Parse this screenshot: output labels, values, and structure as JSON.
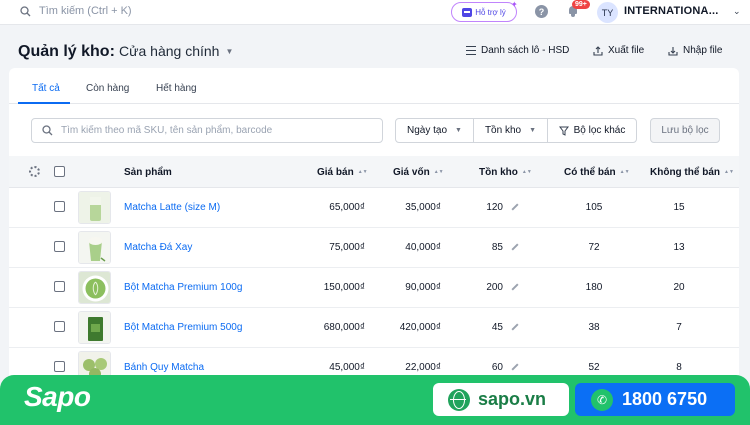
{
  "topbar": {
    "search_placeholder": "Tìm kiếm (Ctrl + K)",
    "help_label": "Hỗ trợ lý",
    "notification_count": "99+",
    "avatar_initials": "TY",
    "org_name": "INTERNATIONA..."
  },
  "header": {
    "title": "Quản lý kho:",
    "store": "Cửa hàng chính",
    "actions": [
      "Danh sách lô - HSD",
      "Xuất file",
      "Nhập file"
    ]
  },
  "tabs": [
    "Tất cả",
    "Còn hàng",
    "Hết hàng"
  ],
  "filters": {
    "search_placeholder": "Tìm kiếm theo mã SKU, tên sản phẩm, barcode",
    "date": "Ngày tạo",
    "stock": "Tồn kho",
    "other": "Bộ lọc khác",
    "save": "Lưu bộ lọc"
  },
  "table": {
    "columns": [
      "Sản phẩm",
      "Giá bán",
      "Giá vốn",
      "Tồn kho",
      "Có thể bán",
      "Không thể bán"
    ],
    "rows": [
      {
        "name": "Matcha Latte (size M)",
        "price": "65,000₫",
        "cost": "35,000₫",
        "stock": "120",
        "available": "105",
        "unavailable": "15"
      },
      {
        "name": "Matcha Đá Xay",
        "price": "75,000₫",
        "cost": "40,000₫",
        "stock": "85",
        "available": "72",
        "unavailable": "13"
      },
      {
        "name": "Bột Matcha Premium 100g",
        "price": "150,000₫",
        "cost": "90,000₫",
        "stock": "200",
        "available": "180",
        "unavailable": "20"
      },
      {
        "name": "Bột Matcha Premium 500g",
        "price": "680,000₫",
        "cost": "420,000₫",
        "stock": "45",
        "available": "38",
        "unavailable": "7"
      },
      {
        "name": "Bánh Quy Matcha",
        "price": "45,000₫",
        "cost": "22,000₫",
        "stock": "60",
        "available": "52",
        "unavailable": "8"
      }
    ]
  },
  "banner": {
    "brand": "Sapo",
    "site": "sapo.vn",
    "phone": "1800 6750"
  },
  "colors": {
    "accent": "#0b6bf2",
    "banner": "#21c26b"
  }
}
